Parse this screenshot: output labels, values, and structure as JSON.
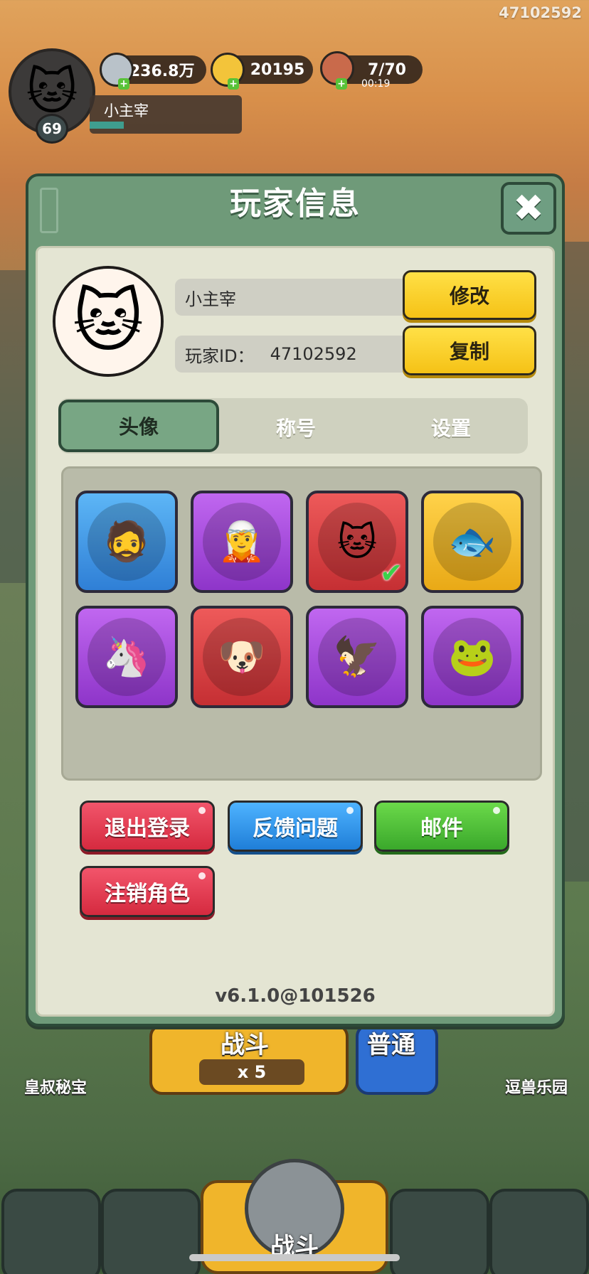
{
  "hud": {
    "user_id": "47102592",
    "level": "69",
    "player_name": "小主宰",
    "resources": [
      {
        "name": "silver-coin",
        "value": "2236.8万"
      },
      {
        "name": "gold-ingot",
        "value": "20195"
      },
      {
        "name": "meat-stamina",
        "value": "7/70",
        "timer": "00:19"
      }
    ]
  },
  "background": {
    "left_feature": "皇叔秘宝",
    "right_feature": "逗兽乐园",
    "battle_cost": "x 5",
    "battle_label_top": "战斗",
    "normal_label_top": "普通",
    "nav_center_label": "战斗"
  },
  "modal": {
    "title": "玩家信息",
    "close_symbol": "✖",
    "profile": {
      "name": "小主宰",
      "id_label": "玩家ID：",
      "id_value": "47102592",
      "edit_button": "修改",
      "copy_button": "复制"
    },
    "tabs": [
      {
        "label": "头像",
        "active": true
      },
      {
        "label": "称号",
        "active": false
      },
      {
        "label": "设置",
        "active": false
      }
    ],
    "avatars": [
      {
        "name": "warrior-avatar",
        "color": "#3b8ee6",
        "glyph": "🧔"
      },
      {
        "name": "witch-avatar",
        "color": "#a94ee0",
        "glyph": "🧝"
      },
      {
        "name": "lucky-cat-avatar",
        "color": "#dc4447",
        "glyph": "🐱",
        "selected": true
      },
      {
        "name": "fish-avatar",
        "color": "#f2bd2c",
        "glyph": "🐟"
      },
      {
        "name": "unicorn-avatar",
        "color": "#a94ee0",
        "glyph": "🦄"
      },
      {
        "name": "corgi-avatar",
        "color": "#dc4447",
        "glyph": "🐶"
      },
      {
        "name": "bird-warrior-avatar",
        "color": "#a94ee0",
        "glyph": "🦅"
      },
      {
        "name": "frog-avatar",
        "color": "#a94ee0",
        "glyph": "🐸"
      }
    ],
    "buttons": {
      "logout": "退出登录",
      "feedback": "反馈问题",
      "mail": "邮件",
      "delete_character": "注销角色"
    },
    "version": "v6.1.0@101526"
  }
}
